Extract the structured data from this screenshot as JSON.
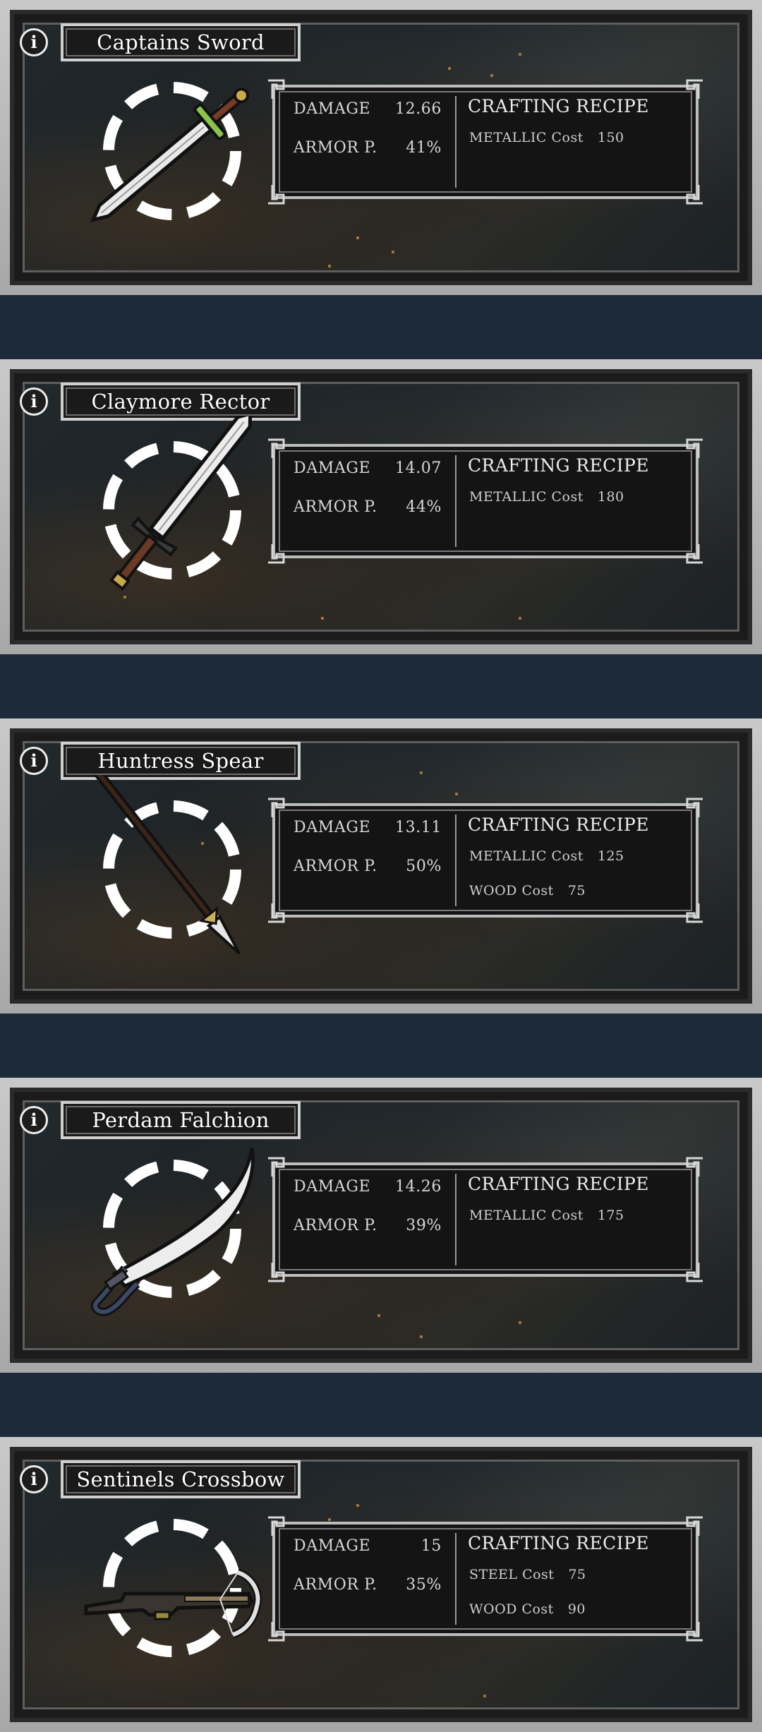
{
  "colors": {
    "page_background": "#1c2a3a",
    "card_frame": "#b8b8b8",
    "text": "#ffffff",
    "spark_accent": "#d89a3c"
  },
  "weapons": [
    {
      "name": "Captains Sword",
      "icon": "sword-icon",
      "damage_label": "DAMAGE",
      "damage_value": "12.66",
      "armor_label": "ARMOR P.",
      "armor_value": "41%",
      "recipe_title": "CRAFTING RECIPE",
      "recipe": [
        {
          "material": "METALLIC Cost",
          "amount": "150"
        }
      ]
    },
    {
      "name": "Claymore Rector",
      "icon": "claymore-icon",
      "damage_label": "DAMAGE",
      "damage_value": "14.07",
      "armor_label": "ARMOR P.",
      "armor_value": "44%",
      "recipe_title": "CRAFTING RECIPE",
      "recipe": [
        {
          "material": "METALLIC Cost",
          "amount": "180"
        }
      ]
    },
    {
      "name": "Huntress Spear",
      "icon": "spear-icon",
      "damage_label": "DAMAGE",
      "damage_value": "13.11",
      "armor_label": "ARMOR P.",
      "armor_value": "50%",
      "recipe_title": "CRAFTING RECIPE",
      "recipe": [
        {
          "material": "METALLIC Cost",
          "amount": "125"
        },
        {
          "material": "WOOD Cost",
          "amount": "75"
        }
      ]
    },
    {
      "name": "Perdam Falchion",
      "icon": "falchion-icon",
      "damage_label": "DAMAGE",
      "damage_value": "14.26",
      "armor_label": "ARMOR P.",
      "armor_value": "39%",
      "recipe_title": "CRAFTING RECIPE",
      "recipe": [
        {
          "material": "METALLIC Cost",
          "amount": "175"
        }
      ]
    },
    {
      "name": "Sentinels Crossbow",
      "icon": "crossbow-icon",
      "damage_label": "DAMAGE",
      "damage_value": "15",
      "armor_label": "ARMOR P.",
      "armor_value": "35%",
      "recipe_title": "CRAFTING RECIPE",
      "recipe": [
        {
          "material": "STEEL Cost",
          "amount": "75"
        },
        {
          "material": "WOOD Cost",
          "amount": "90"
        }
      ]
    }
  ],
  "info_icon_glyph": "i"
}
